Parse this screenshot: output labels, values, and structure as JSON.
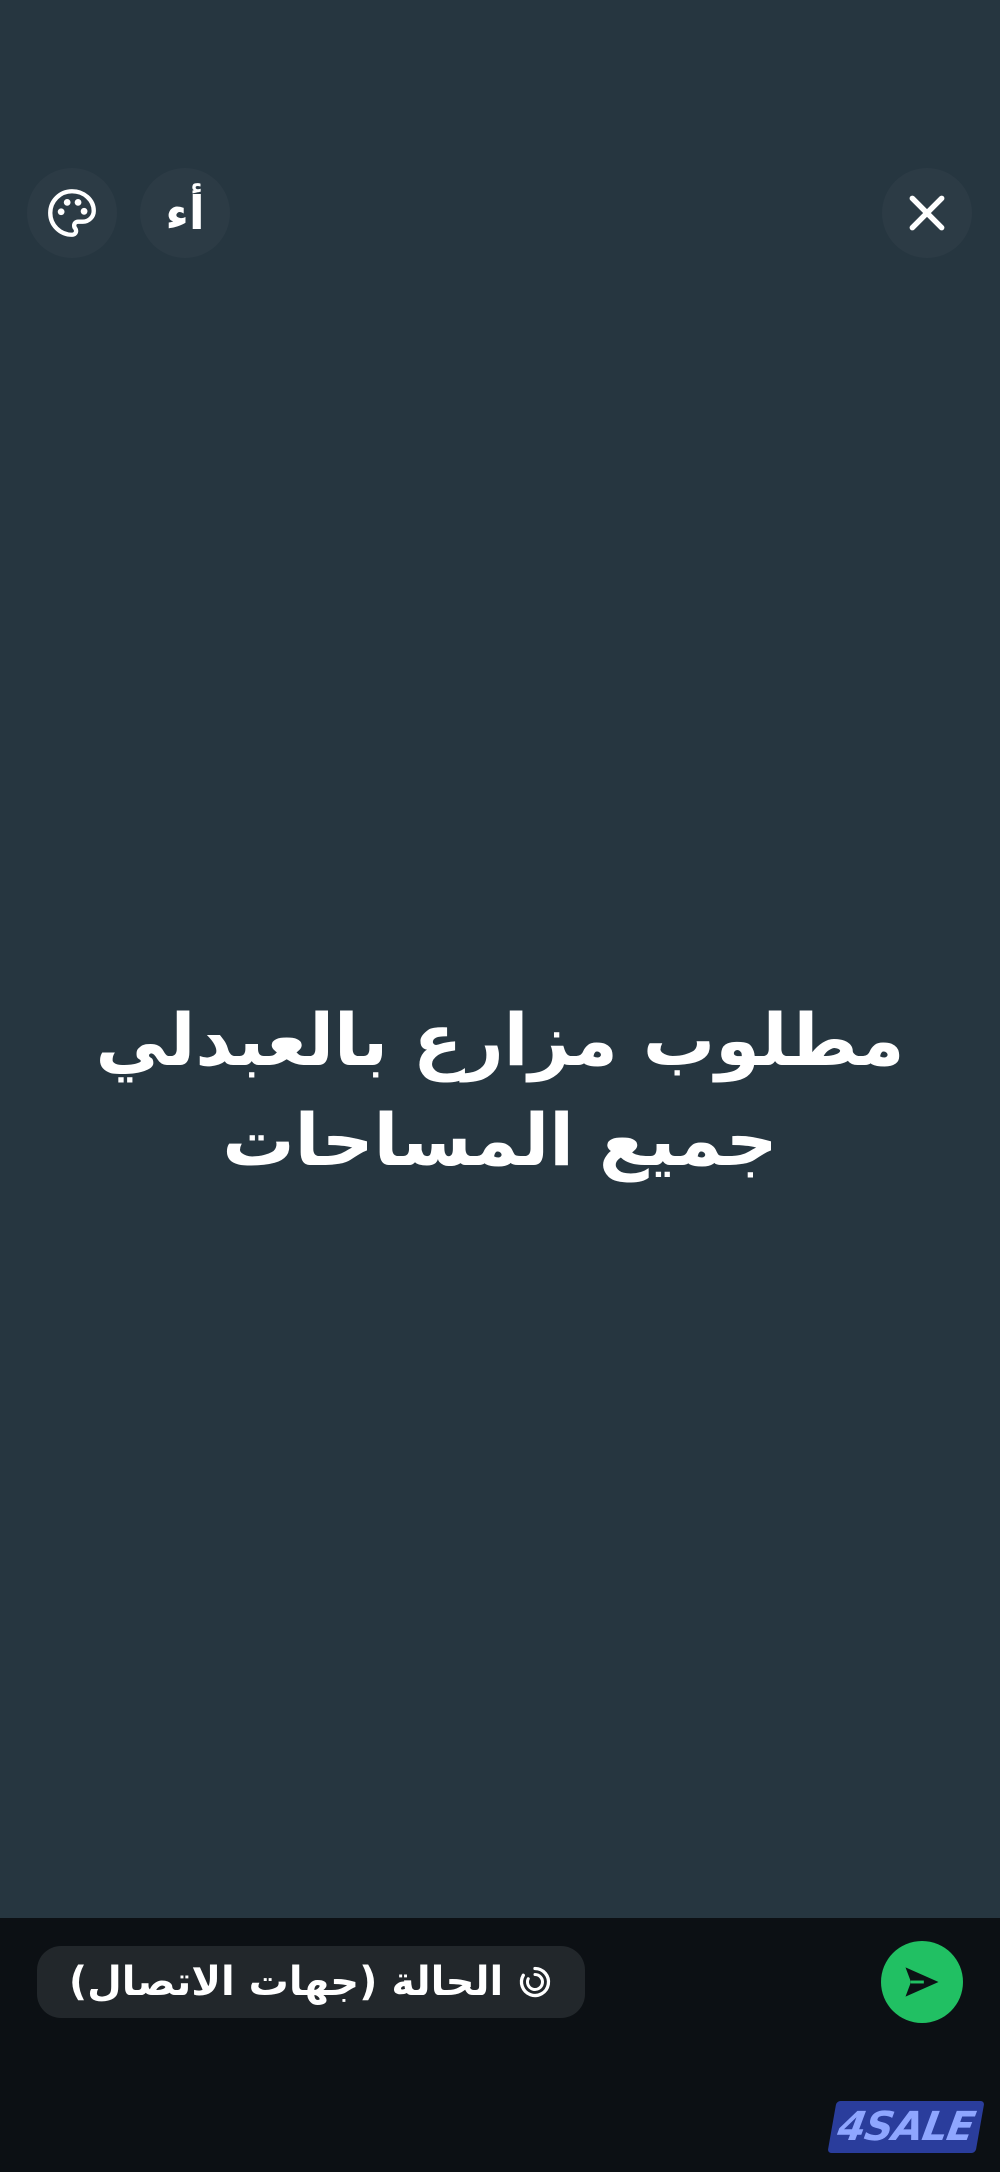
{
  "header": {
    "font_button_label": "أء",
    "icons": {
      "palette": "palette-icon",
      "close": "close-icon"
    }
  },
  "status": {
    "lines": [
      "مطلوب مزارع بالعبدلي",
      "جميع المساحات"
    ],
    "background_color": "#263640",
    "text_color": "#ffffff"
  },
  "footer": {
    "audience_label": "الحالة (جهات الاتصال)",
    "audience_icon": "status-ring-icon",
    "send_icon": "send-icon",
    "send_color": "#21c063"
  },
  "watermark": {
    "text": "4SALE",
    "color": "#2a3d9c"
  }
}
